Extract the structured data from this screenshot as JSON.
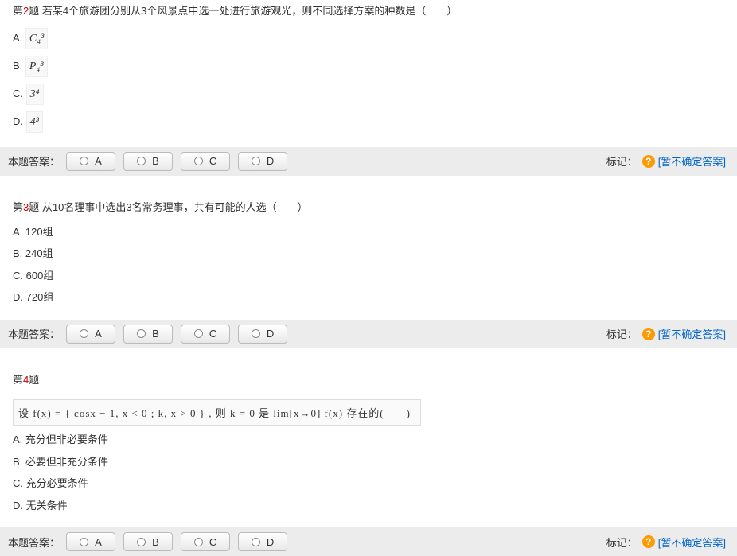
{
  "labels": {
    "answer": "本题答案：",
    "mark": "标记：",
    "help": "?",
    "uncertain": "[暂不确定答案]"
  },
  "answer_buttons": [
    "A",
    "B",
    "C",
    "D"
  ],
  "questions": [
    {
      "prefixWord": "第",
      "num": "2",
      "suffixWord": "题",
      "stem": " 若某4个旅游团分别从3个风景点中选一处进行旅游观光，则不同选择方案的种数是（　　）",
      "opt_letters": [
        "A. ",
        "B. ",
        "C. ",
        "D. "
      ],
      "opt_texts": [
        "C₄³",
        "P₄³",
        "3⁴",
        "4³"
      ],
      "math_style": true
    },
    {
      "prefixWord": "第",
      "num": "3",
      "suffixWord": "题",
      "stem": " 从10名理事中选出3名常务理事，共有可能的人选（　　）",
      "opt_letters": [
        "A. ",
        "B. ",
        "C. ",
        "D. "
      ],
      "opt_texts": [
        "120组",
        "240组",
        "600组",
        "720组"
      ],
      "math_style": false
    },
    {
      "prefixWord": "第",
      "num": "4",
      "suffixWord": "题",
      "stem": "",
      "formula": "设 f(x) = { cosx − 1, x < 0 ; k, x > 0 } , 则 k = 0 是 lim[x→0] f(x) 存在的(　　)",
      "opt_letters": [
        "A. ",
        "B. ",
        "C. ",
        "D. "
      ],
      "opt_texts": [
        "充分但非必要条件",
        "必要但非充分条件",
        "充分必要条件",
        "无关条件"
      ],
      "math_style": false
    }
  ]
}
